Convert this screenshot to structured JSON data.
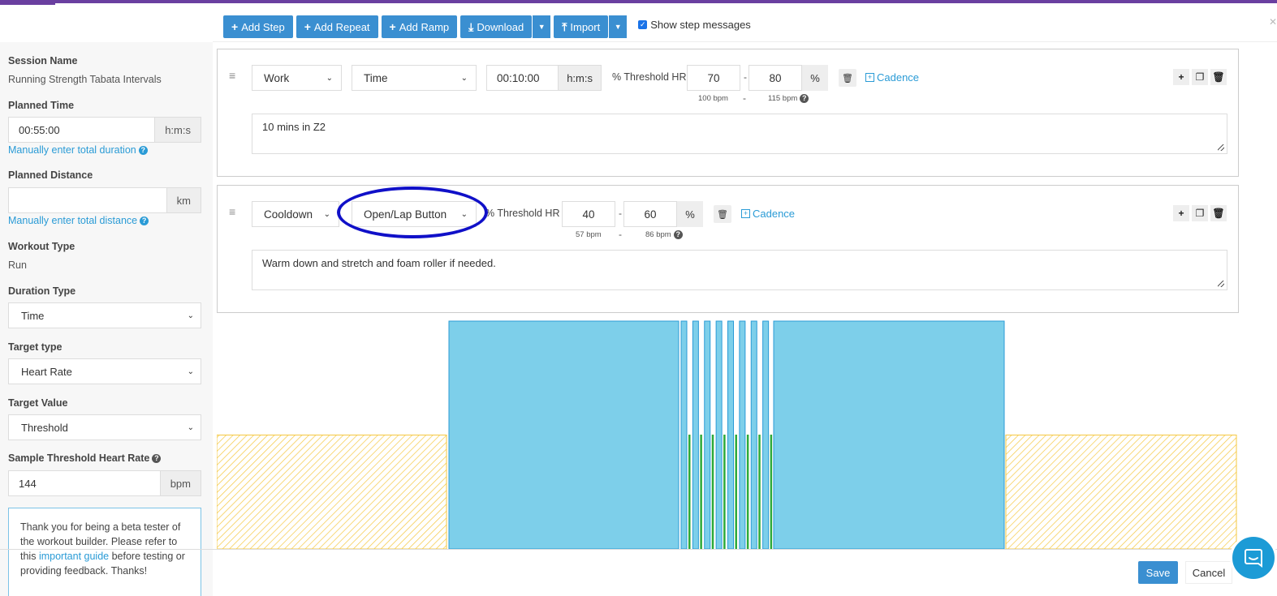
{
  "toolbar": {
    "add_step": "Add Step",
    "add_repeat": "Add Repeat",
    "add_ramp": "Add Ramp",
    "download": "Download",
    "import": "Import",
    "show_step_messages": "Show step messages",
    "show_step_messages_checked": true
  },
  "sidebar": {
    "session_name_label": "Session Name",
    "session_name": "Running Strength Tabata Intervals",
    "planned_time_label": "Planned Time",
    "planned_time": "00:55:00",
    "planned_time_unit": "h:m:s",
    "manual_duration_link": "Manually enter total duration",
    "planned_distance_label": "Planned Distance",
    "planned_distance": "",
    "planned_distance_unit": "km",
    "manual_distance_link": "Manually enter total distance",
    "workout_type_label": "Workout Type",
    "workout_type": "Run",
    "duration_type_label": "Duration Type",
    "duration_type": "Time",
    "target_type_label": "Target type",
    "target_type": "Heart Rate",
    "target_value_label": "Target Value",
    "target_value": "Threshold",
    "sample_hr_label": "Sample Threshold Heart Rate",
    "sample_hr": "144",
    "sample_hr_unit": "bpm",
    "beta_text_1": "Thank you for being a beta tester of the workout builder. Please refer to this ",
    "beta_link": "important guide",
    "beta_text_2": " before testing or providing feedback. Thanks!"
  },
  "steps": [
    {
      "type": "Work",
      "duration_type": "Time",
      "duration": "00:10:00",
      "duration_unit": "h:m:s",
      "target_label": "% Threshold HR",
      "low": "70",
      "high": "80",
      "unit": "%",
      "low_bpm": "100 bpm",
      "high_bpm": "115 bpm",
      "separator": "-",
      "cadence": "Cadence",
      "message": "10 mins in Z2"
    },
    {
      "type": "Cooldown",
      "duration_type": "Open/Lap Button",
      "target_label": "% Threshold HR",
      "low": "40",
      "high": "60",
      "unit": "%",
      "low_bpm": "57 bpm",
      "high_bpm": "86 bpm",
      "separator": "-",
      "cadence": "Cadence",
      "message": "Warm down and stretch and foam roller if needed."
    }
  ],
  "footer": {
    "save": "Save",
    "cancel": "Cancel"
  },
  "colors": {
    "primary": "#3a8fd1",
    "link": "#2a9bd6",
    "chart_work": "#7dcfea",
    "chart_easy": "#f5c842",
    "chart_rest": "#2eaa3a",
    "highlight_ellipse": "#1010c8"
  },
  "chart_data": {
    "type": "bar",
    "blocks": [
      {
        "kind": "warmup",
        "level": 0.5
      },
      {
        "kind": "work",
        "level": 1.0
      },
      {
        "kind": "tabata",
        "intervals": 8,
        "work_level": 1.0,
        "rest_level": 0.5
      },
      {
        "kind": "work",
        "level": 1.0
      },
      {
        "kind": "cooldown",
        "level": 0.5
      }
    ]
  }
}
